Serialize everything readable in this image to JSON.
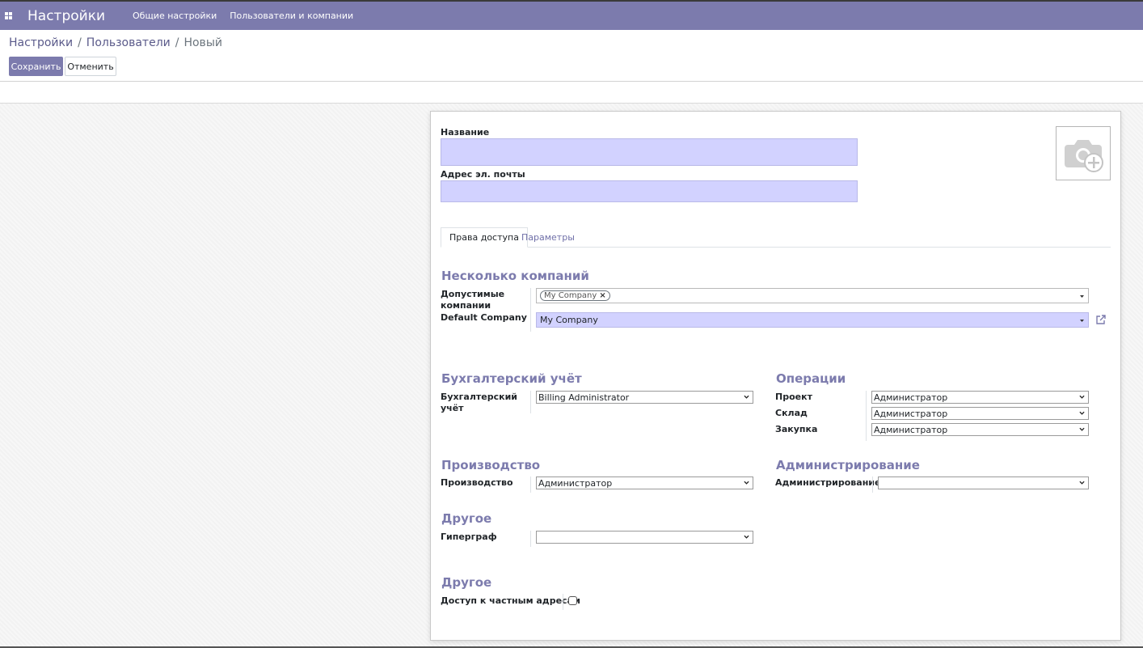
{
  "navbar": {
    "app_title": "Настройки",
    "menu": [
      "Общие настройки",
      "Пользователи и компании"
    ]
  },
  "breadcrumb": {
    "items": [
      "Настройки",
      "Пользователи",
      "Новый"
    ]
  },
  "actions": {
    "save": "Сохранить",
    "cancel": "Отменить"
  },
  "form": {
    "name_label": "Название",
    "name_value": "",
    "email_label": "Адрес эл. почты",
    "email_value": "",
    "avatar_icon": "camera-plus-icon",
    "tabs": [
      "Права доступа",
      "Параметры"
    ],
    "active_tab": "Права доступа",
    "multi_company": {
      "title": "Несколько компаний",
      "allowed_label": "Допустимые компании",
      "allowed_tags": [
        "My Company"
      ],
      "default_label": "Default Company",
      "default_value": "My Company"
    },
    "accounting": {
      "title": "Бухгалтерский учёт",
      "label": "Бухгалтерский учёт",
      "value": "Billing Administrator"
    },
    "operations": {
      "title": "Операции",
      "fields": [
        {
          "label": "Проект",
          "value": "Администратор"
        },
        {
          "label": "Склад",
          "value": "Администратор"
        },
        {
          "label": "Закупка",
          "value": "Администратор"
        }
      ]
    },
    "manufacturing": {
      "title": "Производство",
      "label": "Производство",
      "value": "Администратор"
    },
    "administration": {
      "title": "Администрирование",
      "label": "Администрирование",
      "value": ""
    },
    "other1": {
      "title": "Другое",
      "label": "Гиперграф",
      "value": ""
    },
    "other2": {
      "title": "Другое",
      "label": "Доступ к частным адресам",
      "checked": false
    }
  },
  "colors": {
    "brand": "#7c7bad",
    "required_field": "#d2d2ff"
  }
}
